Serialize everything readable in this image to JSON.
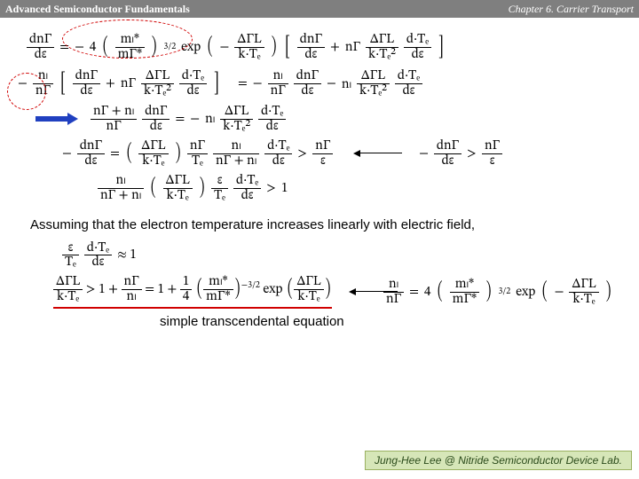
{
  "header": {
    "left": "Advanced Semiconductor Fundamentals",
    "right": "Chapter 6. Carrier Transport"
  },
  "body": {
    "assumption": "Assuming that the electron temperature increases linearly with electric field,",
    "caption": "simple transcendental equation"
  },
  "footer": {
    "credit": "Jung-Hee Lee @ Nitride Semiconductor Device Lab."
  },
  "eq": {
    "dnG_de": "dnΓ",
    "de": "dε",
    "mL": "mₗ*",
    "mG": "mΓ*",
    "threehalf": "3/2",
    "neg_threehalf": "−3/2",
    "exp": "exp",
    "dGL": "ΔΓL",
    "kTe": "k·Tₑ",
    "kTe2": "k·Tₑ²",
    "nG": "nΓ",
    "nL": "nₗ",
    "dTe": "d·Tₑ",
    "Te": "Tₑ",
    "eps": "ε",
    "four": "4",
    "one": "1",
    "quarter": "1/4",
    "eq_sign": "=",
    "minus": "−",
    "plus": "+",
    "gt": ">",
    "approx1": "≈ 1"
  }
}
